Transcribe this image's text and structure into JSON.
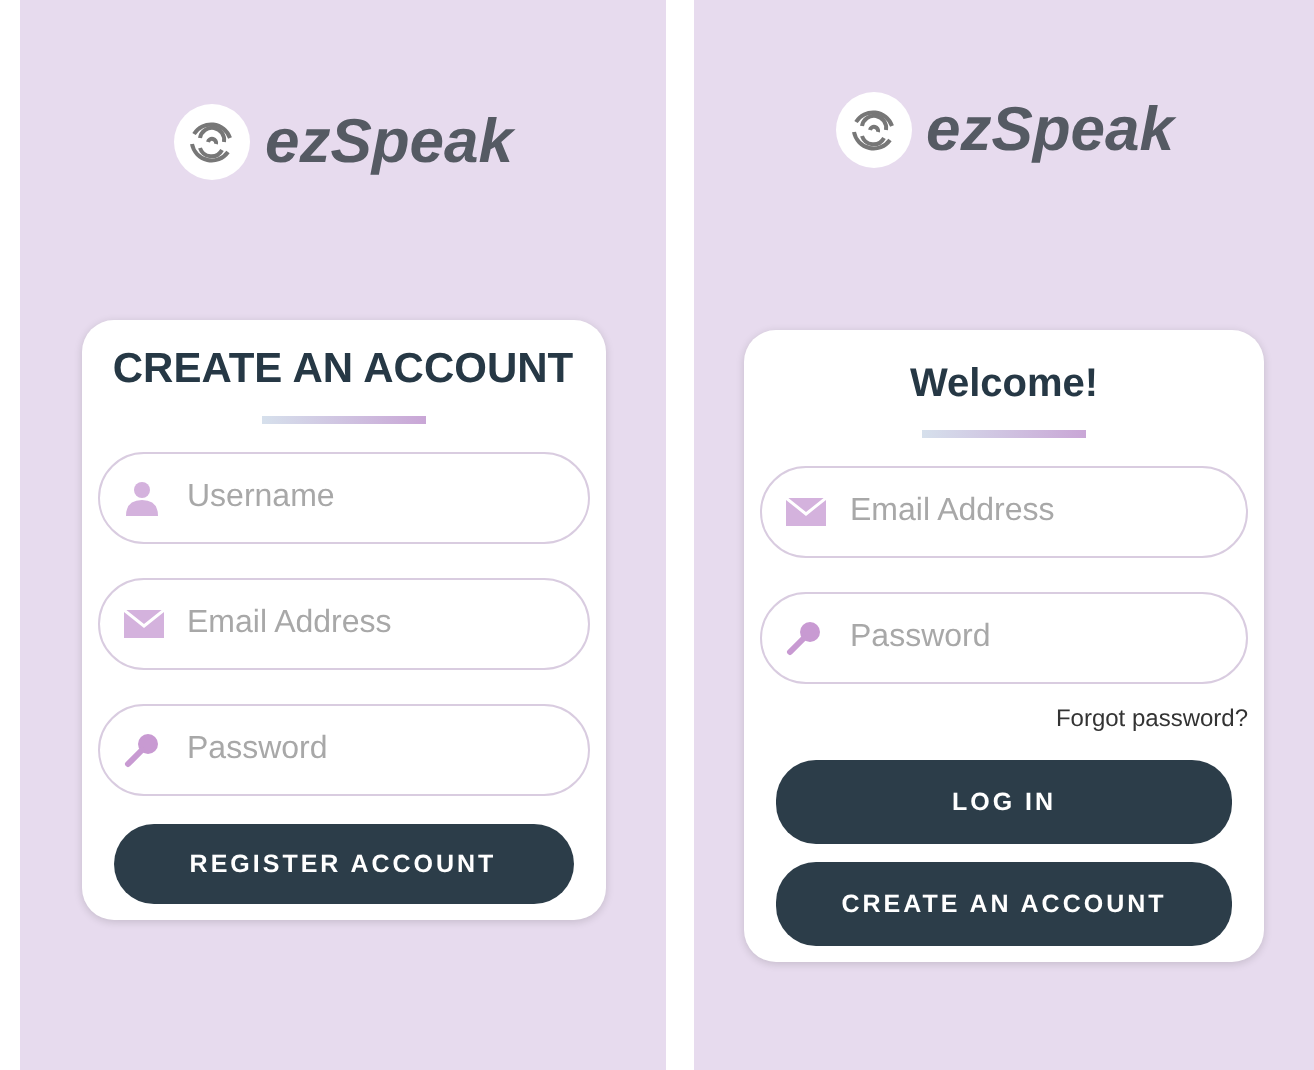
{
  "screens": [
    {
      "logo": "ezSpeak",
      "title": "CREATE AN ACCOUNT",
      "fields": [
        {
          "kind": "user",
          "placeholder": "Username"
        },
        {
          "kind": "mail",
          "placeholder": "Email Address"
        },
        {
          "kind": "key",
          "placeholder": "Password"
        }
      ],
      "buttons": [
        "REGISTER ACCOUNT"
      ]
    },
    {
      "logo": "ezSpeak",
      "title": "Welcome!",
      "fields": [
        {
          "kind": "mail",
          "placeholder": "Email Address"
        },
        {
          "kind": "key",
          "placeholder": "Password"
        }
      ],
      "link": "Forgot password?",
      "buttons": [
        "LOG IN",
        "CREATE AN ACCOUNT"
      ]
    }
  ]
}
